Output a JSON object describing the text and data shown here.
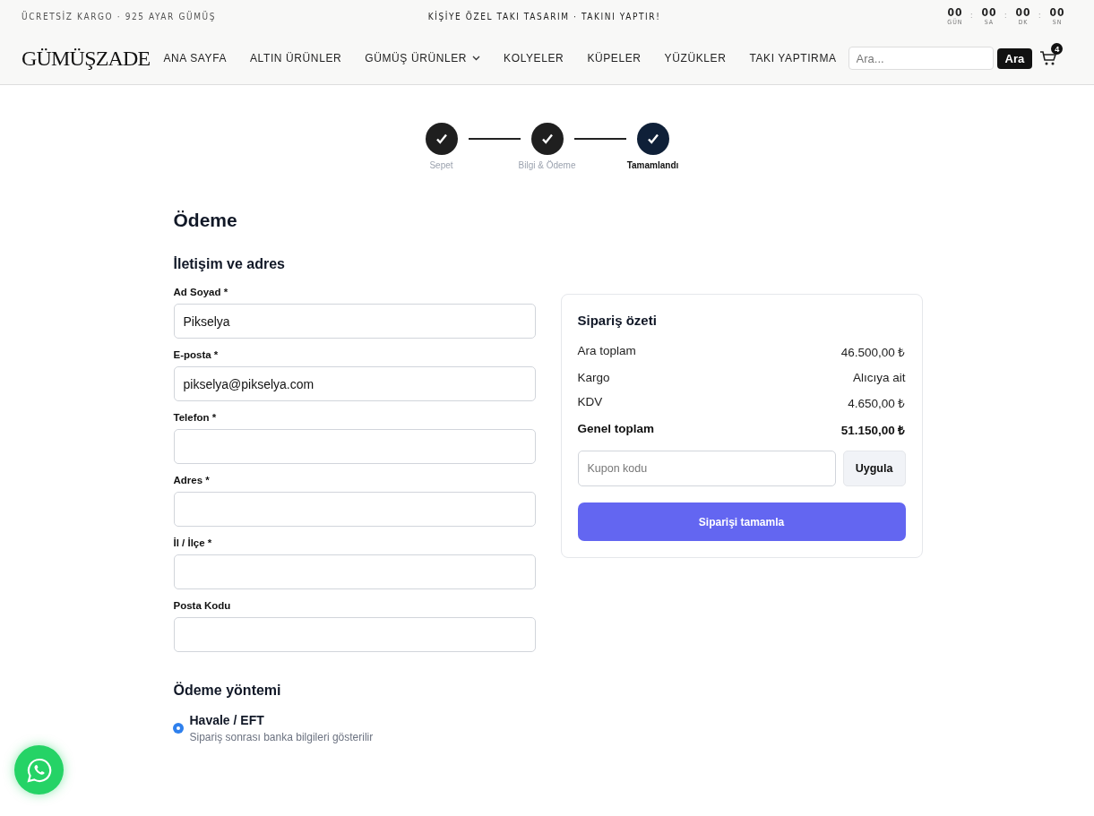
{
  "topbar": {
    "left": "ÜCRETSİZ KARGO · 925 AYAR GÜMÜŞ",
    "center": "KİŞİYE ÖZEL TAKI TASARIM · TAKINI YAPTIR!",
    "countdown": [
      {
        "value": "00",
        "unit": "GÜN"
      },
      {
        "value": "00",
        "unit": "SA"
      },
      {
        "value": "00",
        "unit": "DK"
      },
      {
        "value": "00",
        "unit": "SN"
      }
    ],
    "separator": ":"
  },
  "header": {
    "logo": "GÜMÜŞZADE",
    "nav": [
      {
        "label": "ANA SAYFA",
        "has_menu": false
      },
      {
        "label": "ALTIN ÜRÜNLER",
        "has_menu": false
      },
      {
        "label": "GÜMÜŞ ÜRÜNLER",
        "has_menu": true
      },
      {
        "label": "KOLYELER",
        "has_menu": false
      },
      {
        "label": "KÜPELER",
        "has_menu": false
      },
      {
        "label": "YÜZÜKLER",
        "has_menu": false
      },
      {
        "label": "TAKI YAPTIRMA",
        "has_menu": false
      }
    ],
    "search": {
      "placeholder": "Ara...",
      "button": "Ara"
    },
    "cart_count": "4"
  },
  "steps": [
    {
      "label": "Sepet",
      "done": true,
      "current": false
    },
    {
      "label": "Bilgi & Ödeme",
      "done": true,
      "current": false
    },
    {
      "label": "Tamamlandı",
      "done": true,
      "current": true
    }
  ],
  "title": "Ödeme",
  "contact": {
    "heading": "İletişim ve adres",
    "fields": [
      {
        "label": "Ad Soyad *",
        "value": "Pikselya"
      },
      {
        "label": "E-posta *",
        "value": "pikselya@pikselya.com"
      },
      {
        "label": "Telefon *"
      },
      {
        "label": "Adres *"
      },
      {
        "label": "İl / İlçe *"
      },
      {
        "label": "Posta Kodu"
      }
    ]
  },
  "payment": {
    "heading": "Ödeme yöntemi",
    "options": [
      {
        "label": "Havale / EFT",
        "note": "Sipariş sonrası banka bilgileri gösterilir",
        "selected": true
      }
    ]
  },
  "summary": {
    "heading": "Sipariş özeti",
    "rows": [
      {
        "label": "Ara toplam",
        "value": "46.500,00 ₺",
        "total": false
      },
      {
        "label": "Kargo",
        "value": "Alıcıya ait",
        "total": false
      },
      {
        "label": "KDV",
        "value": "4.650,00 ₺",
        "total": false
      },
      {
        "label": "Genel toplam",
        "value": "51.150,00 ₺",
        "total": true
      }
    ],
    "coupon": {
      "placeholder": "Kupon kodu",
      "button": "Uygula"
    },
    "submit": "Siparişi tamamla"
  }
}
